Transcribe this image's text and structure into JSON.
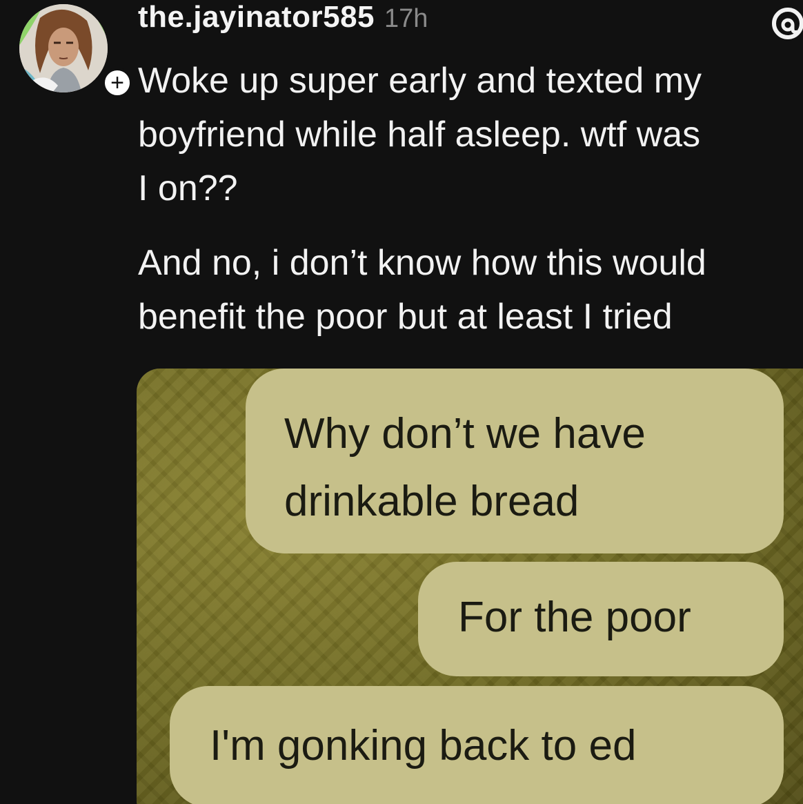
{
  "post": {
    "username": "the.jayinator585",
    "time": "17h",
    "follow_symbol": "+",
    "paragraph_1_lines": [
      "Woke up super early and texted my",
      "boyfriend while half asleep. wtf was",
      "I on??"
    ],
    "paragraph_2_lines": [
      "And no, i don’t know how this would",
      "benefit the poor but at least I tried"
    ]
  },
  "attached_image": {
    "messages": [
      {
        "lines": [
          "Why don’t we have",
          "drinkable bread"
        ]
      },
      {
        "lines": [
          "For the poor"
        ]
      },
      {
        "lines": [
          "I'm gonking back to ed"
        ]
      }
    ]
  },
  "icons": {
    "avatar": "avatar-illustration",
    "follow": "plus-icon",
    "app": "threads-icon"
  },
  "colors": {
    "background": "#111111",
    "text": "#f2f2f2",
    "muted": "#8a8a8a",
    "bubble": "#c6c08a"
  }
}
